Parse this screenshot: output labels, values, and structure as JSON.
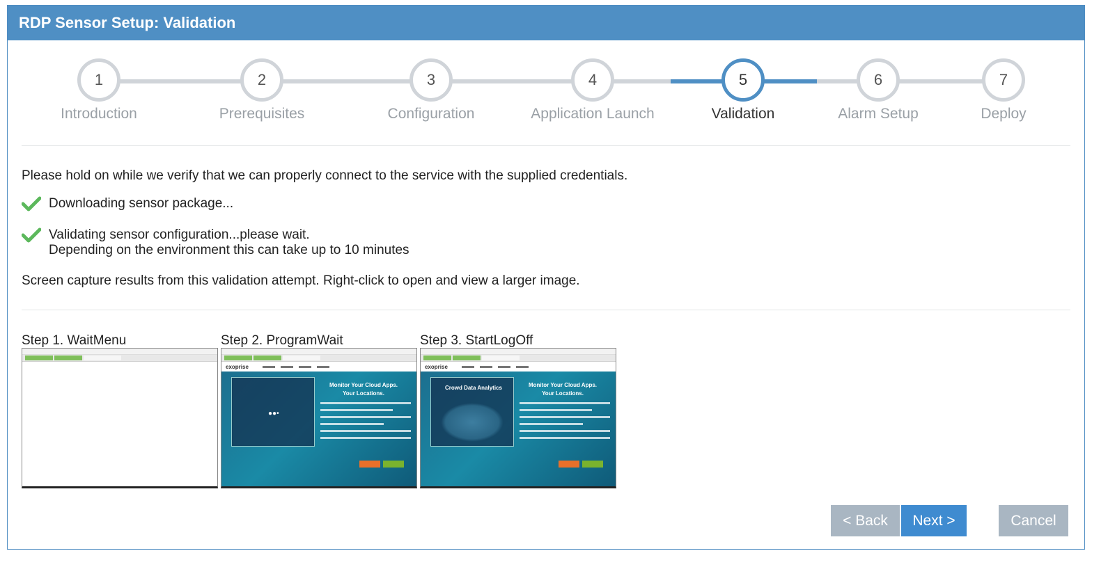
{
  "dialog": {
    "title": "RDP Sensor Setup: Validation"
  },
  "wizard": {
    "steps": [
      {
        "number": "1",
        "label": "Introduction"
      },
      {
        "number": "2",
        "label": "Prerequisites"
      },
      {
        "number": "3",
        "label": "Configuration"
      },
      {
        "number": "4",
        "label": "Application Launch"
      },
      {
        "number": "5",
        "label": "Validation"
      },
      {
        "number": "6",
        "label": "Alarm Setup"
      },
      {
        "number": "7",
        "label": "Deploy"
      }
    ],
    "active_step": "5"
  },
  "content": {
    "intro": "Please hold on while we verify that we can properly connect to the service with the supplied credentials.",
    "tasks": [
      {
        "line1": "Downloading sensor package...",
        "line2": ""
      },
      {
        "line1": "Validating sensor configuration...please wait.",
        "line2": "Depending on the environment this can take up to 10 minutes"
      }
    ],
    "capture_note": "Screen capture results from this validation attempt. Right-click to open and view a larger image."
  },
  "captures": [
    {
      "caption": "Step 1. WaitMenu"
    },
    {
      "caption": "Step 2. ProgramWait",
      "site_logo": "exoprise",
      "hero_title_1": "Monitor Your Cloud Apps.",
      "hero_title_2": "Your Locations."
    },
    {
      "caption": "Step 3. StartLogOff",
      "site_logo": "exoprise",
      "hero_title_1": "Monitor Your Cloud Apps.",
      "hero_title_2": "Your Locations.",
      "panel_title": "Crowd Data Analytics"
    }
  ],
  "buttons": {
    "back": "< Back",
    "next": "Next >",
    "cancel": "Cancel"
  },
  "colors": {
    "header": "#4f8fc4",
    "active": "#4f8fc4",
    "inactive": "#d0d4d9",
    "check": "#5cb85c",
    "next_button": "#3f8bd0",
    "disabled_button": "#a9b6c2"
  }
}
